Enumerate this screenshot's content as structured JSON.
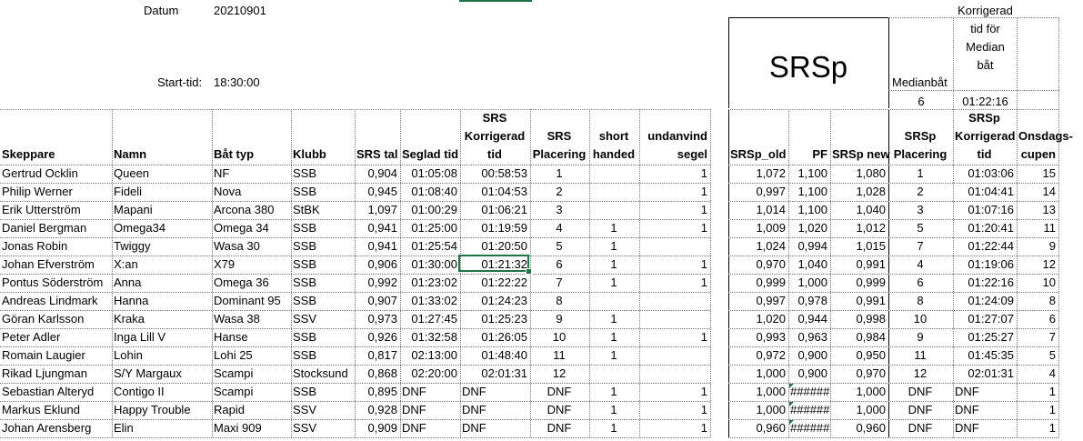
{
  "datum_label": "Datum",
  "datum_value": "20210901",
  "start_label": "Start-tid:",
  "start_value": "18:30:00",
  "srsp_title": "SRSp",
  "median_label": "Medianbåt",
  "median_value": "6",
  "korr_median_label": [
    "Korrigerad",
    "tid för",
    "Median",
    "båt"
  ],
  "korr_median_value": "01:22:16",
  "headers": {
    "skeppare": "Skeppare",
    "namn": "Namn",
    "battyp": "Båt typ",
    "klubb": "Klubb",
    "srstal": "SRS tal",
    "seglad": "Seglad tid",
    "srskorr": [
      "SRS",
      "Korrigerad",
      "tid"
    ],
    "srsplac": [
      "SRS",
      "Placering"
    ],
    "short": [
      "short",
      "handed"
    ],
    "undanvind": [
      "undanvind",
      "segel"
    ],
    "srsp_old": "SRSp_old",
    "pf": "PF",
    "srsp_new": "SRSp new",
    "srsp_plac": [
      "SRSp",
      "Placering"
    ],
    "srsp_korr": [
      "SRSp",
      "Korrigerad",
      "tid"
    ],
    "onsdags": [
      "Onsdags-",
      "cupen"
    ]
  },
  "rows": [
    {
      "skeppare": "Gertrud Ocklin",
      "namn": "Queen",
      "battyp": "NF",
      "klubb": "SSB",
      "srstal": "0,904",
      "seglad": "01:05:08",
      "srskorr": "00:58:53",
      "srsplac": "1",
      "short": "",
      "undanvind": "1",
      "srsp_old": "1,072",
      "pf": "1,100",
      "srsp_new": "1,080",
      "srsp_plac": "1",
      "srsp_korr": "01:03:06",
      "onsdags": "15"
    },
    {
      "skeppare": "Philip Werner",
      "namn": "Fideli",
      "battyp": "Nova",
      "klubb": "SSB",
      "srstal": "0,945",
      "seglad": "01:08:40",
      "srskorr": "01:04:53",
      "srsplac": "2",
      "short": "",
      "undanvind": "1",
      "srsp_old": "0,997",
      "pf": "1,100",
      "srsp_new": "1,028",
      "srsp_plac": "2",
      "srsp_korr": "01:04:41",
      "onsdags": "14"
    },
    {
      "skeppare": "Erik Utterström",
      "namn": "Mapani",
      "battyp": "Arcona 380",
      "klubb": "StBK",
      "srstal": "1,097",
      "seglad": "01:00:29",
      "srskorr": "01:06:21",
      "srsplac": "3",
      "short": "",
      "undanvind": "1",
      "srsp_old": "1,014",
      "pf": "1,100",
      "srsp_new": "1,040",
      "srsp_plac": "3",
      "srsp_korr": "01:07:16",
      "onsdags": "13"
    },
    {
      "skeppare": "Daniel Bergman",
      "namn": "Omega34",
      "battyp": "Omega 34",
      "klubb": "SSB",
      "srstal": "0,941",
      "seglad": "01:25:00",
      "srskorr": "01:19:59",
      "srsplac": "4",
      "short": "1",
      "undanvind": "1",
      "srsp_old": "1,009",
      "pf": "1,020",
      "srsp_new": "1,012",
      "srsp_plac": "5",
      "srsp_korr": "01:20:41",
      "onsdags": "11"
    },
    {
      "skeppare": "Jonas Robin",
      "namn": "Twiggy",
      "battyp": "Wasa 30",
      "klubb": "SSB",
      "srstal": "0,941",
      "seglad": "01:25:54",
      "srskorr": "01:20:50",
      "srsplac": "5",
      "short": "1",
      "undanvind": "",
      "srsp_old": "1,024",
      "pf": "0,994",
      "srsp_new": "1,015",
      "srsp_plac": "7",
      "srsp_korr": "01:22:44",
      "onsdags": "9"
    },
    {
      "skeppare": "Johan Efverström",
      "namn": "X:an",
      "battyp": "X79",
      "klubb": "SSB",
      "srstal": "0,906",
      "seglad": "01:30:00",
      "srskorr": "01:21:32",
      "srsplac": "6",
      "short": "1",
      "undanvind": "1",
      "srsp_old": "0,970",
      "pf": "1,040",
      "srsp_new": "0,991",
      "srsp_plac": "4",
      "srsp_korr": "01:19:06",
      "onsdags": "12"
    },
    {
      "skeppare": "Pontus Söderström",
      "namn": "Anna",
      "battyp": "Omega 36",
      "klubb": "SSB",
      "srstal": "0,992",
      "seglad": "01:23:02",
      "srskorr": "01:22:22",
      "srsplac": "7",
      "short": "1",
      "undanvind": "1",
      "srsp_old": "0,999",
      "pf": "1,000",
      "srsp_new": "0,999",
      "srsp_plac": "6",
      "srsp_korr": "01:22:16",
      "onsdags": "10"
    },
    {
      "skeppare": "Andreas Lindmark",
      "namn": "Hanna",
      "battyp": "Dominant 95",
      "klubb": "SSB",
      "srstal": "0,907",
      "seglad": "01:33:02",
      "srskorr": "01:24:23",
      "srsplac": "8",
      "short": "",
      "undanvind": "",
      "srsp_old": "0,997",
      "pf": "0,978",
      "srsp_new": "0,991",
      "srsp_plac": "8",
      "srsp_korr": "01:24:09",
      "onsdags": "8"
    },
    {
      "skeppare": "Göran Karlsson",
      "namn": "Kraka",
      "battyp": "Wasa 38",
      "klubb": "SSV",
      "srstal": "0,973",
      "seglad": "01:27:45",
      "srskorr": "01:25:23",
      "srsplac": "9",
      "short": "1",
      "undanvind": "",
      "srsp_old": "1,020",
      "pf": "0,944",
      "srsp_new": "0,998",
      "srsp_plac": "10",
      "srsp_korr": "01:27:07",
      "onsdags": "6"
    },
    {
      "skeppare": "Peter Adler",
      "namn": "Inga Lill V",
      "battyp": "Hanse",
      "klubb": "SSB",
      "srstal": "0,926",
      "seglad": "01:32:58",
      "srskorr": "01:26:05",
      "srsplac": "10",
      "short": "1",
      "undanvind": "1",
      "srsp_old": "0,993",
      "pf": "0,963",
      "srsp_new": "0,984",
      "srsp_plac": "9",
      "srsp_korr": "01:25:27",
      "onsdags": "7"
    },
    {
      "skeppare": "Romain Laugier",
      "namn": "Lohin",
      "battyp": "Lohi 25",
      "klubb": "SSB",
      "srstal": "0,817",
      "seglad": "02:13:00",
      "srskorr": "01:48:40",
      "srsplac": "11",
      "short": "1",
      "undanvind": "",
      "srsp_old": "0,972",
      "pf": "0,900",
      "srsp_new": "0,950",
      "srsp_plac": "11",
      "srsp_korr": "01:45:35",
      "onsdags": "5"
    },
    {
      "skeppare": "Rikad Ljungman",
      "namn": "S/Y Margaux",
      "battyp": "Scampi",
      "klubb": "Stocksund",
      "srstal": "0,868",
      "seglad": "02:20:00",
      "srskorr": "02:01:31",
      "srsplac": "12",
      "short": "",
      "undanvind": "",
      "srsp_old": "1,000",
      "pf": "0,900",
      "srsp_new": "0,970",
      "srsp_plac": "12",
      "srsp_korr": "02:01:31",
      "onsdags": "4"
    },
    {
      "skeppare": "Sebastian Alteryd",
      "namn": "Contigo II",
      "battyp": "Scampi",
      "klubb": "SSB",
      "srstal": "0,895",
      "seglad": "DNF",
      "srskorr": "DNF",
      "srsplac": "DNF",
      "short": "1",
      "undanvind": "1",
      "srsp_old": "1,000",
      "pf": "######",
      "srsp_new": "1,000",
      "srsp_plac": "DNF",
      "srsp_korr": "DNF",
      "onsdags": "1"
    },
    {
      "skeppare": "Markus Eklund",
      "namn": "Happy Trouble",
      "battyp": "Rapid",
      "klubb": "SSV",
      "srstal": "0,928",
      "seglad": "DNF",
      "srskorr": "DNF",
      "srsplac": "DNF",
      "short": "1",
      "undanvind": "1",
      "srsp_old": "1,000",
      "pf": "######",
      "srsp_new": "1,000",
      "srsp_plac": "DNF",
      "srsp_korr": "DNF",
      "onsdags": "1"
    },
    {
      "skeppare": "Johan Arensberg",
      "namn": "Elin",
      "battyp": "Maxi 909",
      "klubb": "SSV",
      "srstal": "0,909",
      "seglad": "DNF",
      "srskorr": "DNF",
      "srsplac": "DNF",
      "short": "1",
      "undanvind": "1",
      "srsp_old": "0,960",
      "pf": "######",
      "srsp_new": "0,960",
      "srsp_plac": "DNF",
      "srsp_korr": "DNF",
      "onsdags": "1"
    }
  ]
}
